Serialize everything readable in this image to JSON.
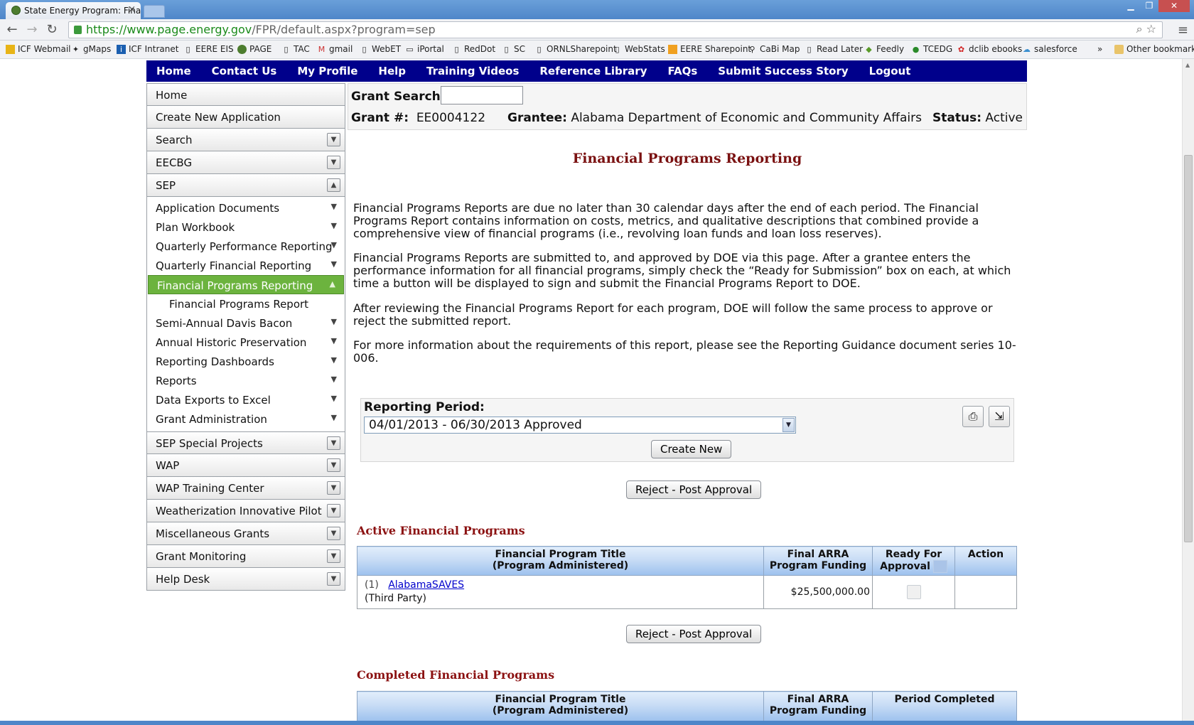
{
  "browser": {
    "tab_title": "State Energy Program: Finar",
    "tab_close": "×",
    "url_scheme_host": "https://www.page.energy.gov",
    "url_path": "/FPR/default.aspx?program=sep",
    "bookmarks": [
      "ICF Webmail",
      "gMaps",
      "ICF Intranet",
      "EERE EIS",
      "PAGE",
      "TAC",
      "gmail",
      "WebET",
      "iPortal",
      "RedDot",
      "SC",
      "ORNLSharepoint",
      "WebStats",
      "EERE Sharepoint",
      "CaBi Map",
      "Read Later",
      "Feedly",
      "TCEDG",
      "dclib ebooks",
      "salesforce"
    ],
    "bookmarks_overflow": "»",
    "other_bookmarks": "Other bookmarks"
  },
  "topnav": [
    "Home",
    "Contact Us",
    "My Profile",
    "Help",
    "Training Videos",
    "Reference Library",
    "FAQs",
    "Submit Success Story",
    "Logout"
  ],
  "sidebar": {
    "top": [
      "Home",
      "Create New Application"
    ],
    "groups_before": [
      "Search",
      "EECBG"
    ],
    "sep_label": "SEP",
    "sep_items": [
      {
        "label": "Application Documents"
      },
      {
        "label": "Plan Workbook"
      },
      {
        "label": "Quarterly Performance Reporting"
      },
      {
        "label": "Quarterly Financial Reporting"
      },
      {
        "label": "Financial Programs Reporting",
        "active": true
      },
      {
        "label": "Financial Programs Report",
        "child": true
      },
      {
        "label": "Semi-Annual Davis Bacon"
      },
      {
        "label": "Annual Historic Preservation"
      },
      {
        "label": "Reporting Dashboards"
      },
      {
        "label": "Reports"
      },
      {
        "label": "Data Exports to Excel"
      },
      {
        "label": "Grant Administration"
      }
    ],
    "groups_after": [
      "SEP Special Projects",
      "WAP",
      "WAP Training Center",
      "Weatherization Innovative Pilot",
      "Miscellaneous Grants",
      "Grant Monitoring",
      "Help Desk"
    ]
  },
  "grant": {
    "search_label": "Grant Search:",
    "search_value": "",
    "number_label": "Grant #:",
    "number": "EE0004122",
    "grantee_label": "Grantee:",
    "grantee": "Alabama Department of Economic and Community Affairs",
    "status_label": "Status:",
    "status": "Active"
  },
  "page": {
    "title": "Financial Programs Reporting",
    "paragraphs": [
      "Financial Programs Reports are due no later than 30 calendar days after the end of each period. The Financial Programs Report contains information on costs, metrics, and qualitative descriptions that combined provide a comprehensive view of financial programs (i.e., revolving loan funds and loan loss reserves).",
      "Financial Programs Reports are submitted to, and approved by DOE via this page. After a grantee enters the performance information for all financial programs, simply check the “Ready for Submission” box on each, at which time a button will be displayed to sign and submit the Financial Programs Report to DOE.",
      "After reviewing the Financial Programs Report for each program, DOE will follow the same process to approve or reject the submitted report.",
      "For more information about the requirements of this report, please see the Reporting Guidance document series 10-006."
    ],
    "reporting_period_label": "Reporting Period:",
    "reporting_period_value": "04/01/2013 - 06/30/2013 Approved",
    "create_new": "Create New",
    "reject_button": "Reject - Post Approval",
    "active_title": "Active Financial Programs",
    "completed_title": "Completed Financial Programs",
    "active_headers": {
      "title": "Financial Program Title",
      "title_sub": "(Program Administered)",
      "funding": "Final ARRA Program Funding",
      "ready": "Ready For Approval",
      "action": "Action"
    },
    "active_rows": [
      {
        "index": "(1)",
        "name": "AlabamaSAVES",
        "admin": "(Third Party)",
        "funding": "$25,500,000.00"
      }
    ],
    "completed_headers": {
      "title": "Financial Program Title",
      "title_sub": "(Program Administered)",
      "funding": "Final ARRA Program Funding",
      "period": "Period Completed"
    }
  },
  "colors": {
    "nav_bg": "#00008b",
    "active_green": "#6cb33e",
    "title_red": "#7a1111"
  }
}
